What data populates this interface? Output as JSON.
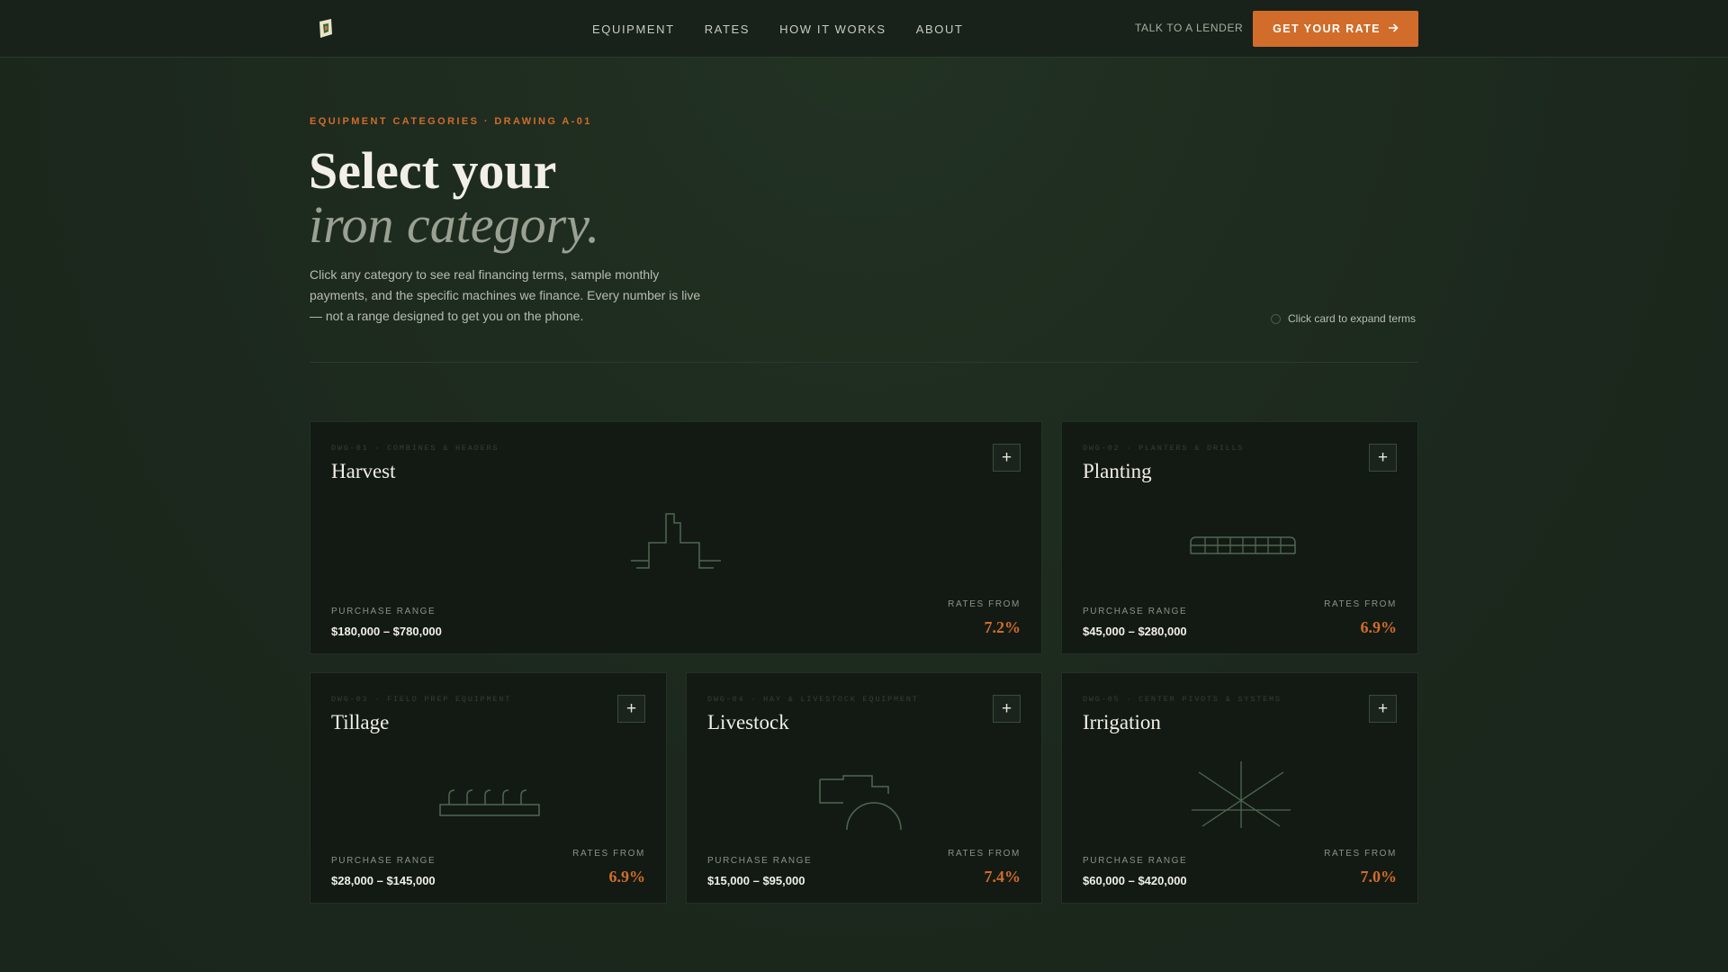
{
  "nav": {
    "links": [
      "EQUIPMENT",
      "RATES",
      "HOW IT WORKS",
      "ABOUT"
    ],
    "talk_label": "TALK TO A LENDER",
    "cta_label": "GET YOUR RATE"
  },
  "hero": {
    "eyebrow": "EQUIPMENT CATEGORIES · DRAWING A-01",
    "title_line1": "Select your",
    "title_line2": "iron category.",
    "lede": "Click any category to see real financing terms, sample monthly payments, and the specific machines we finance. Every number is live — not a range designed to get you on the phone.",
    "hint": "Click card to expand terms"
  },
  "labels": {
    "purchase_range": "PURCHASE RANGE",
    "rates_from": "RATES FROM"
  },
  "cards": [
    {
      "code": "DWG-01 · COMBINES & HEADERS",
      "title": "Harvest",
      "range": "$180,000 – $780,000",
      "rate": "7.2%"
    },
    {
      "code": "DWG-02 · PLANTERS & DRILLS",
      "title": "Planting",
      "range": "$45,000 – $280,000",
      "rate": "6.9%"
    },
    {
      "code": "DWG-03 · FIELD PREP EQUIPMENT",
      "title": "Tillage",
      "range": "$28,000 – $145,000",
      "rate": "6.9%"
    },
    {
      "code": "DWG-04 · HAY & LIVESTOCK EQUIPMENT",
      "title": "Livestock",
      "range": "$15,000 – $95,000",
      "rate": "7.4%"
    },
    {
      "code": "DWG-05 · CENTER PIVOTS & SYSTEMS",
      "title": "Irrigation",
      "range": "$60,000 – $420,000",
      "rate": "7.0%"
    }
  ],
  "colors": {
    "accent": "#d16c2a",
    "background": "#1d2a1f",
    "card": "#131a14"
  },
  "icons": [
    "logo-icon",
    "arrow-right-icon",
    "plus-icon"
  ]
}
